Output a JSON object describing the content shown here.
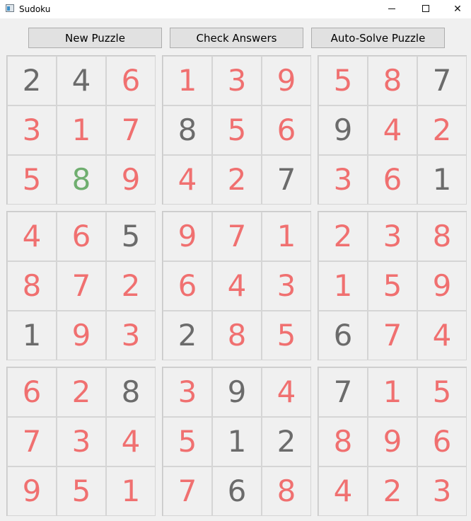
{
  "window": {
    "title": "Sudoku",
    "controls": {
      "minimize": "—",
      "maximize": "☐",
      "close": "✕"
    }
  },
  "toolbar": {
    "new_puzzle_label": "New Puzzle",
    "check_answers_label": "Check Answers",
    "auto_solve_label": "Auto-Solve Puzzle"
  },
  "colors": {
    "given": "#6b6b6b",
    "filled": "#f07070",
    "correct": "#6fae6f"
  },
  "board": {
    "rows": [
      [
        {
          "value": "2",
          "kind": "given"
        },
        {
          "value": "4",
          "kind": "given"
        },
        {
          "value": "6",
          "kind": "filled"
        },
        {
          "value": "1",
          "kind": "filled"
        },
        {
          "value": "3",
          "kind": "filled"
        },
        {
          "value": "9",
          "kind": "filled"
        },
        {
          "value": "5",
          "kind": "filled"
        },
        {
          "value": "8",
          "kind": "filled"
        },
        {
          "value": "7",
          "kind": "given"
        }
      ],
      [
        {
          "value": "3",
          "kind": "filled"
        },
        {
          "value": "1",
          "kind": "filled"
        },
        {
          "value": "7",
          "kind": "filled"
        },
        {
          "value": "8",
          "kind": "given"
        },
        {
          "value": "5",
          "kind": "filled"
        },
        {
          "value": "6",
          "kind": "filled"
        },
        {
          "value": "9",
          "kind": "given"
        },
        {
          "value": "4",
          "kind": "filled"
        },
        {
          "value": "2",
          "kind": "filled"
        }
      ],
      [
        {
          "value": "5",
          "kind": "filled"
        },
        {
          "value": "8",
          "kind": "correct"
        },
        {
          "value": "9",
          "kind": "filled"
        },
        {
          "value": "4",
          "kind": "filled"
        },
        {
          "value": "2",
          "kind": "filled"
        },
        {
          "value": "7",
          "kind": "given"
        },
        {
          "value": "3",
          "kind": "filled"
        },
        {
          "value": "6",
          "kind": "filled"
        },
        {
          "value": "1",
          "kind": "given"
        }
      ],
      [
        {
          "value": "4",
          "kind": "filled"
        },
        {
          "value": "6",
          "kind": "filled"
        },
        {
          "value": "5",
          "kind": "given"
        },
        {
          "value": "9",
          "kind": "filled"
        },
        {
          "value": "7",
          "kind": "filled"
        },
        {
          "value": "1",
          "kind": "filled"
        },
        {
          "value": "2",
          "kind": "filled"
        },
        {
          "value": "3",
          "kind": "filled"
        },
        {
          "value": "8",
          "kind": "filled"
        }
      ],
      [
        {
          "value": "8",
          "kind": "filled"
        },
        {
          "value": "7",
          "kind": "filled"
        },
        {
          "value": "2",
          "kind": "filled"
        },
        {
          "value": "6",
          "kind": "filled"
        },
        {
          "value": "4",
          "kind": "filled"
        },
        {
          "value": "3",
          "kind": "filled"
        },
        {
          "value": "1",
          "kind": "filled"
        },
        {
          "value": "5",
          "kind": "filled"
        },
        {
          "value": "9",
          "kind": "filled"
        }
      ],
      [
        {
          "value": "1",
          "kind": "given"
        },
        {
          "value": "9",
          "kind": "filled"
        },
        {
          "value": "3",
          "kind": "filled"
        },
        {
          "value": "2",
          "kind": "given"
        },
        {
          "value": "8",
          "kind": "filled"
        },
        {
          "value": "5",
          "kind": "filled"
        },
        {
          "value": "6",
          "kind": "given"
        },
        {
          "value": "7",
          "kind": "filled"
        },
        {
          "value": "4",
          "kind": "filled"
        }
      ],
      [
        {
          "value": "6",
          "kind": "filled"
        },
        {
          "value": "2",
          "kind": "filled"
        },
        {
          "value": "8",
          "kind": "given"
        },
        {
          "value": "3",
          "kind": "filled"
        },
        {
          "value": "9",
          "kind": "given"
        },
        {
          "value": "4",
          "kind": "filled"
        },
        {
          "value": "7",
          "kind": "given"
        },
        {
          "value": "1",
          "kind": "filled"
        },
        {
          "value": "5",
          "kind": "filled"
        }
      ],
      [
        {
          "value": "7",
          "kind": "filled"
        },
        {
          "value": "3",
          "kind": "filled"
        },
        {
          "value": "4",
          "kind": "filled"
        },
        {
          "value": "5",
          "kind": "filled"
        },
        {
          "value": "1",
          "kind": "given"
        },
        {
          "value": "2",
          "kind": "given"
        },
        {
          "value": "8",
          "kind": "filled"
        },
        {
          "value": "9",
          "kind": "filled"
        },
        {
          "value": "6",
          "kind": "filled"
        }
      ],
      [
        {
          "value": "9",
          "kind": "filled"
        },
        {
          "value": "5",
          "kind": "filled"
        },
        {
          "value": "1",
          "kind": "filled"
        },
        {
          "value": "7",
          "kind": "filled"
        },
        {
          "value": "6",
          "kind": "given"
        },
        {
          "value": "8",
          "kind": "filled"
        },
        {
          "value": "4",
          "kind": "filled"
        },
        {
          "value": "2",
          "kind": "filled"
        },
        {
          "value": "3",
          "kind": "filled"
        }
      ]
    ]
  }
}
